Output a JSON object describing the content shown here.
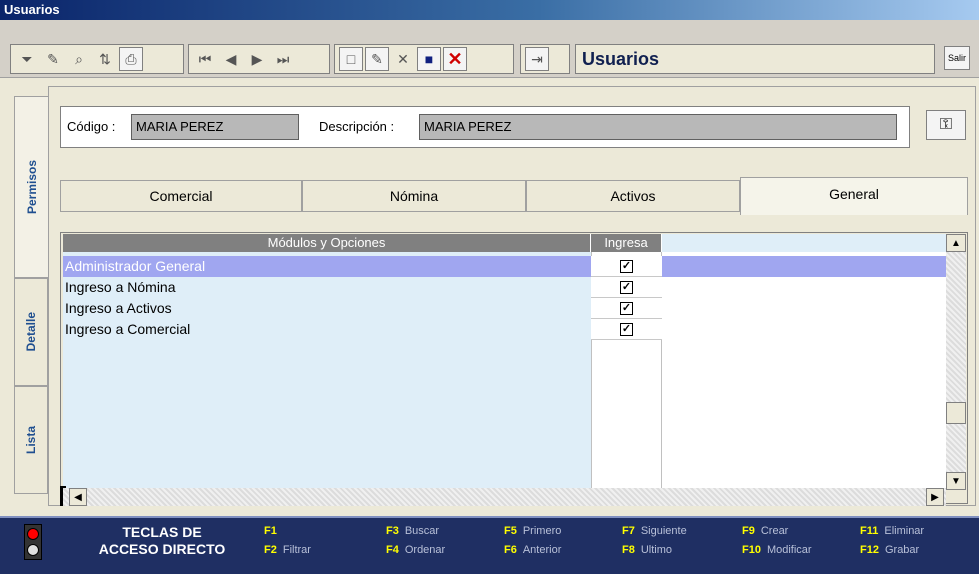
{
  "window": {
    "title": "Usuarios"
  },
  "toolbar": {
    "title": "Usuarios",
    "buttons": [
      "filter-icon",
      "edit-icon",
      "binoculars-icon",
      "sort-icon",
      "printer-icon",
      "first-icon",
      "previous-icon",
      "next-icon",
      "last-icon",
      "new-icon",
      "modify-icon",
      "delete-icon",
      "save-icon",
      "cancel-icon",
      "exit-icon"
    ],
    "right_button": "Salir"
  },
  "side_tabs": [
    "Permisos",
    "Detalle",
    "Lista"
  ],
  "fields": {
    "codigo_label": "Código :",
    "codigo_value": "MARIA PEREZ",
    "descripcion_label": "Descripción :",
    "descripcion_value": "MARIA PEREZ"
  },
  "tabs": [
    "Comercial",
    "Nómina",
    "Activos",
    "General"
  ],
  "active_tab": "General",
  "grid": {
    "headers": [
      "Módulos y Opciones",
      "Ingresa"
    ],
    "rows": [
      {
        "label": "Administrador General",
        "checked": true
      },
      {
        "label": "Ingreso a Nómina",
        "checked": true
      },
      {
        "label": "Ingreso a Activos",
        "checked": true
      },
      {
        "label": "Ingreso a Comercial",
        "checked": true
      }
    ],
    "check_glyph": "✓"
  },
  "footer": {
    "teclas_line1": "TECLAS DE",
    "teclas_line2": "ACCESO DIRECTO",
    "keys": [
      {
        "key": "F1",
        "label": ""
      },
      {
        "key": "F2",
        "label": "Filtrar"
      },
      {
        "key": "F3",
        "label": "Buscar"
      },
      {
        "key": "F4",
        "label": "Ordenar"
      },
      {
        "key": "F5",
        "label": "Primero"
      },
      {
        "key": "F6",
        "label": "Anterior"
      },
      {
        "key": "F7",
        "label": "Siguiente"
      },
      {
        "key": "F8",
        "label": "Ultimo"
      },
      {
        "key": "F9",
        "label": "Crear"
      },
      {
        "key": "F10",
        "label": "Modificar"
      },
      {
        "key": "F11",
        "label": "Eliminar"
      },
      {
        "key": "F12",
        "label": "Grabar"
      }
    ]
  },
  "colors": {
    "title_bar": "#0a246a",
    "selected_row": "#a0a6f0",
    "footer": "#1f2f63",
    "key_color": "#ffff00"
  }
}
